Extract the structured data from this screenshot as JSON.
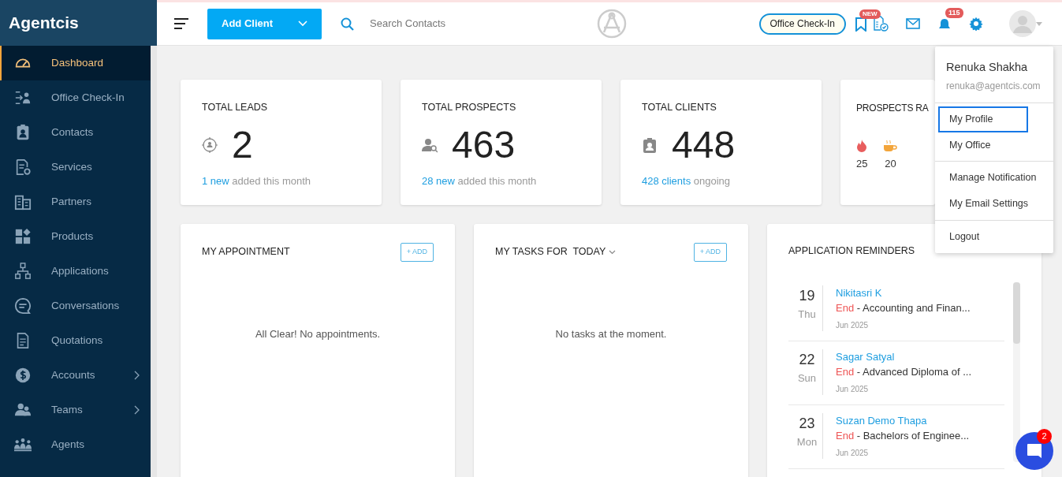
{
  "brand": "Agentcis",
  "header": {
    "add_button": "Add Client",
    "search_placeholder": "Search Contacts",
    "checkin_button": "Office Check-In",
    "new_badge": "NEW",
    "notification_count": "115"
  },
  "sidebar": {
    "items": [
      {
        "label": "Dashboard",
        "selected": true,
        "expandable": false
      },
      {
        "label": "Office Check-In",
        "selected": false,
        "expandable": false
      },
      {
        "label": "Contacts",
        "selected": false,
        "expandable": false
      },
      {
        "label": "Services",
        "selected": false,
        "expandable": false
      },
      {
        "label": "Partners",
        "selected": false,
        "expandable": false
      },
      {
        "label": "Products",
        "selected": false,
        "expandable": false
      },
      {
        "label": "Applications",
        "selected": false,
        "expandable": false
      },
      {
        "label": "Conversations",
        "selected": false,
        "expandable": false
      },
      {
        "label": "Quotations",
        "selected": false,
        "expandable": false
      },
      {
        "label": "Accounts",
        "selected": false,
        "expandable": true
      },
      {
        "label": "Teams",
        "selected": false,
        "expandable": true
      },
      {
        "label": "Agents",
        "selected": false,
        "expandable": false
      }
    ]
  },
  "stats": [
    {
      "title": "TOTAL LEADS",
      "value": "2",
      "sub_link": "1 new",
      "sub_text": "added this month"
    },
    {
      "title": "TOTAL PROSPECTS",
      "value": "463",
      "sub_link": "28 new",
      "sub_text": "added this month"
    },
    {
      "title": "TOTAL CLIENTS",
      "value": "448",
      "sub_link": "428 clients",
      "sub_text": "ongoing"
    }
  ],
  "rating": {
    "title": "PROSPECTS RA",
    "ratings": [
      {
        "kind": "hot",
        "count": "25"
      },
      {
        "kind": "warm",
        "count": "20"
      }
    ]
  },
  "appointments": {
    "title": "MY APPOINTMENT",
    "add": "+ ADD",
    "empty": "All Clear! No appointments."
  },
  "tasks": {
    "title": "MY TASKS FOR  TODAY",
    "add": "+ ADD",
    "empty": "No tasks at the moment."
  },
  "reminders": {
    "title": "APPLICATION REMINDERS",
    "items": [
      {
        "day": "19",
        "weekday": "Thu",
        "name": "Nikitasri K",
        "status": "End",
        "course": " - Accounting and Finan...",
        "month": "Jun 2025"
      },
      {
        "day": "22",
        "weekday": "Sun",
        "name": "Sagar Satyal",
        "status": "End",
        "course": " - Advanced Diploma of ...",
        "month": "Jun 2025"
      },
      {
        "day": "23",
        "weekday": "Mon",
        "name": "Suzan Demo Thapa",
        "status": "End",
        "course": " - Bachelors of Enginee...",
        "month": "Jun 2025"
      }
    ]
  },
  "user_menu": {
    "name": "Renuka Shakha",
    "email": "renuka@agentcis.com",
    "groups": [
      [
        {
          "label": "My Profile",
          "selected": true
        },
        {
          "label": "My Office",
          "selected": false
        }
      ],
      [
        {
          "label": "Manage Notification",
          "selected": false
        },
        {
          "label": "My Email Settings",
          "selected": false
        }
      ],
      [
        {
          "label": "Logout",
          "selected": false
        }
      ]
    ]
  },
  "chat": {
    "count": "2"
  }
}
